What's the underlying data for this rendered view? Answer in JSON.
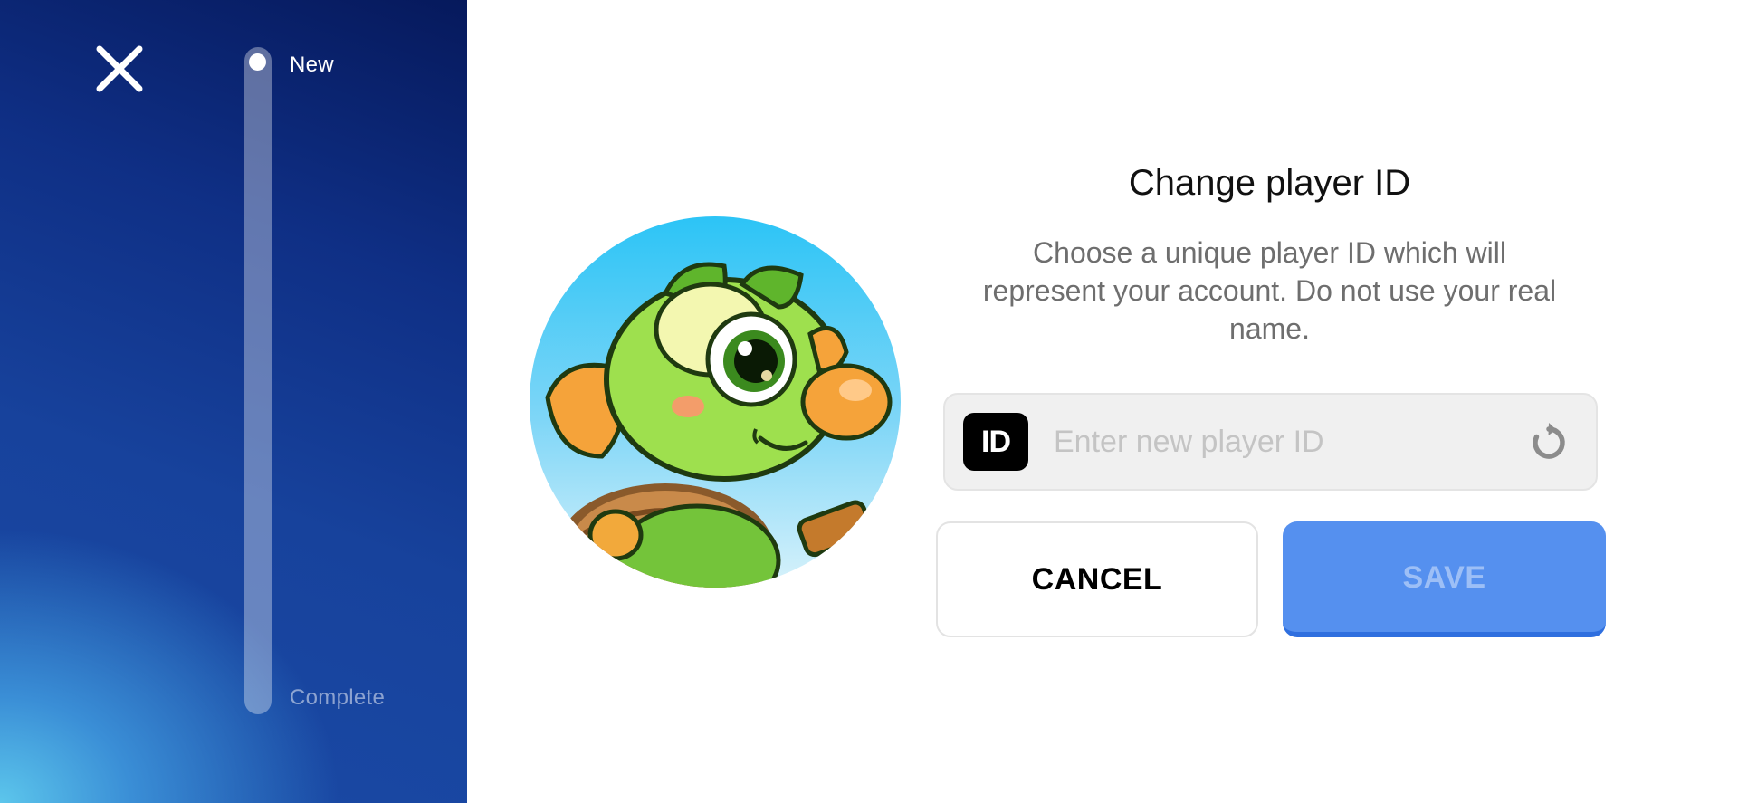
{
  "side_panel": {
    "close_icon": "close-icon",
    "stages": {
      "start": "New",
      "end": "Complete"
    }
  },
  "avatar": {
    "description_icon": "green-turtle-avatar"
  },
  "dialog": {
    "title": "Change player ID",
    "description": "Choose a unique player ID which will represent your account. Do not use your real name.",
    "id_badge": "ID",
    "input_placeholder": "Enter new player ID",
    "input_value": "",
    "refresh_icon": "refresh-icon",
    "cancel_label": "CANCEL",
    "save_label": "SAVE"
  },
  "colors": {
    "panel_dark": "#06195c",
    "panel_light": "#5cc6ec",
    "save_button": "#5590ef",
    "save_text_disabled": "#9dbff6"
  }
}
